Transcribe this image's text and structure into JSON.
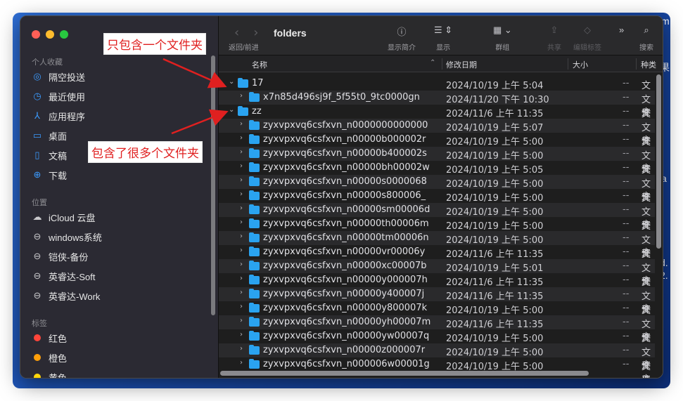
{
  "desktop": {
    "edge_texts": [
      "m",
      "果",
      "a",
      "d.",
      "2."
    ]
  },
  "sidebar": {
    "sections": [
      {
        "title": "个人收藏",
        "items": [
          {
            "label": "隔空投送",
            "icon": "airdrop-icon"
          },
          {
            "label": "最近使用",
            "icon": "clock-icon"
          },
          {
            "label": "应用程序",
            "icon": "applications-icon"
          },
          {
            "label": "桌面",
            "icon": "desktop-icon"
          },
          {
            "label": "文稿",
            "icon": "document-icon"
          },
          {
            "label": "下载",
            "icon": "download-icon"
          }
        ]
      },
      {
        "title": "位置",
        "items": [
          {
            "label": "iCloud 云盘",
            "icon": "cloud-icon"
          },
          {
            "label": "windows系统",
            "icon": "drive-icon"
          },
          {
            "label": "铠侠-备份",
            "icon": "drive-icon"
          },
          {
            "label": "英睿达-Soft",
            "icon": "drive-icon"
          },
          {
            "label": "英睿达-Work",
            "icon": "drive-icon"
          }
        ]
      },
      {
        "title": "标签",
        "items": [
          {
            "label": "红色",
            "color": "#ff453a"
          },
          {
            "label": "橙色",
            "color": "#ff9f0a"
          },
          {
            "label": "黄色",
            "color": "#ffd60a"
          }
        ]
      }
    ]
  },
  "toolbar": {
    "back_forward_label": "返回/前进",
    "title": "folders",
    "buttons": [
      {
        "label": "显示简介",
        "icon": "info-icon"
      },
      {
        "label": "显示",
        "icon": "list-view-icon"
      },
      {
        "label": "群组",
        "icon": "group-icon"
      },
      {
        "label": "共享",
        "icon": "share-icon"
      },
      {
        "label": "编辑标签",
        "icon": "tag-icon"
      },
      {
        "label": "",
        "icon": "more-icon"
      },
      {
        "label": "搜索",
        "icon": "search-icon"
      }
    ]
  },
  "columns": {
    "name": "名称",
    "modified": "修改日期",
    "size": "大小",
    "kind": "种类"
  },
  "rows": [
    {
      "name": "17",
      "date": "2024/10/19 上午 5:04",
      "size": "--",
      "kind": "文件夹",
      "level": 0,
      "expanded": true
    },
    {
      "name": "x7n85d496sj9f_5f55t0_9tc0000gn",
      "date": "2024/11/20 下午 10:30",
      "size": "--",
      "kind": "文件夹",
      "level": 1,
      "expanded": false
    },
    {
      "name": "zz",
      "date": "2024/11/6 上午 11:35",
      "size": "--",
      "kind": "文件夹",
      "level": 0,
      "expanded": true
    },
    {
      "name": "zyxvpxvq6csfxvn_n0000000000000",
      "date": "2024/10/19 上午 5:07",
      "size": "--",
      "kind": "文件夹",
      "level": 1,
      "expanded": false
    },
    {
      "name": "zyxvpxvq6csfxvn_n00000b000002r",
      "date": "2024/10/19 上午 5:00",
      "size": "--",
      "kind": "文件夹",
      "level": 1,
      "expanded": false
    },
    {
      "name": "zyxvpxvq6csfxvn_n00000b400002s",
      "date": "2024/10/19 上午 5:00",
      "size": "--",
      "kind": "文件夹",
      "level": 1,
      "expanded": false
    },
    {
      "name": "zyxvpxvq6csfxvn_n00000bh00002w",
      "date": "2024/10/19 上午 5:05",
      "size": "--",
      "kind": "文件夹",
      "level": 1,
      "expanded": false
    },
    {
      "name": "zyxvpxvq6csfxvn_n00000s0000068",
      "date": "2024/10/19 上午 5:00",
      "size": "--",
      "kind": "文件夹",
      "level": 1,
      "expanded": false
    },
    {
      "name": "zyxvpxvq6csfxvn_n00000s800006_",
      "date": "2024/10/19 上午 5:00",
      "size": "--",
      "kind": "文件夹",
      "level": 1,
      "expanded": false
    },
    {
      "name": "zyxvpxvq6csfxvn_n00000sm00006d",
      "date": "2024/10/19 上午 5:00",
      "size": "--",
      "kind": "文件夹",
      "level": 1,
      "expanded": false
    },
    {
      "name": "zyxvpxvq6csfxvn_n00000th00006m",
      "date": "2024/10/19 上午 5:00",
      "size": "--",
      "kind": "文件夹",
      "level": 1,
      "expanded": false
    },
    {
      "name": "zyxvpxvq6csfxvn_n00000tm00006n",
      "date": "2024/10/19 上午 5:00",
      "size": "--",
      "kind": "文件夹",
      "level": 1,
      "expanded": false
    },
    {
      "name": "zyxvpxvq6csfxvn_n00000vr00006y",
      "date": "2024/11/6 上午 11:35",
      "size": "--",
      "kind": "文件夹",
      "level": 1,
      "expanded": false
    },
    {
      "name": "zyxvpxvq6csfxvn_n00000xc00007b",
      "date": "2024/10/19 上午 5:01",
      "size": "--",
      "kind": "文件夹",
      "level": 1,
      "expanded": false
    },
    {
      "name": "zyxvpxvq6csfxvn_n00000y000007h",
      "date": "2024/11/6 上午 11:35",
      "size": "--",
      "kind": "文件夹",
      "level": 1,
      "expanded": false
    },
    {
      "name": "zyxvpxvq6csfxvn_n00000y400007j",
      "date": "2024/11/6 上午 11:35",
      "size": "--",
      "kind": "文件夹",
      "level": 1,
      "expanded": false
    },
    {
      "name": "zyxvpxvq6csfxvn_n00000y800007k",
      "date": "2024/10/19 上午 5:00",
      "size": "--",
      "kind": "文件夹",
      "level": 1,
      "expanded": false
    },
    {
      "name": "zyxvpxvq6csfxvn_n00000yh00007m",
      "date": "2024/11/6 上午 11:35",
      "size": "--",
      "kind": "文件夹",
      "level": 1,
      "expanded": false
    },
    {
      "name": "zyxvpxvq6csfxvn_n00000yw00007q",
      "date": "2024/10/19 上午 5:00",
      "size": "--",
      "kind": "文件夹",
      "level": 1,
      "expanded": false
    },
    {
      "name": "zyxvpxvq6csfxvn_n00000z000007r",
      "date": "2024/10/19 上午 5:00",
      "size": "--",
      "kind": "文件夹",
      "level": 1,
      "expanded": false
    },
    {
      "name": "zyxvpxvq6csfxvn_n000006w00001g",
      "date": "2024/10/19 上午 5:00",
      "size": "--",
      "kind": "文件夹",
      "level": 1,
      "expanded": false
    }
  ],
  "annotations": {
    "callout_top": "只包含一个文件夹",
    "callout_bottom": "包含了很多个文件夹",
    "color": "#e02020"
  }
}
